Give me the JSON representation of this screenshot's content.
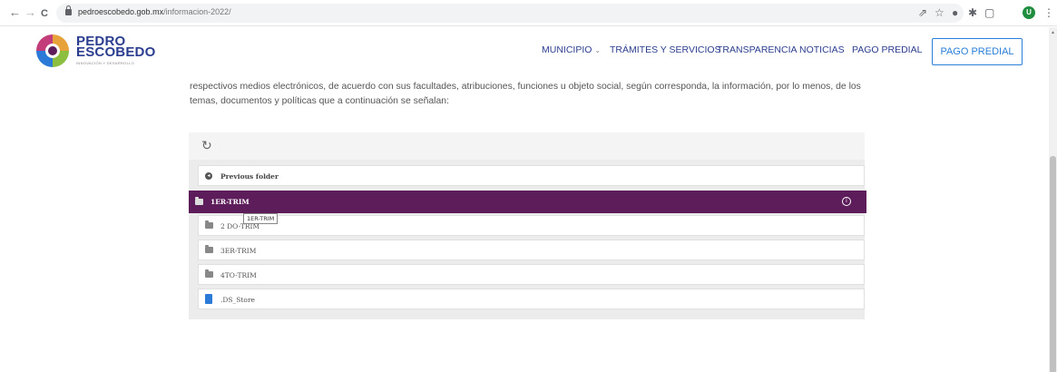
{
  "browser": {
    "back": "←",
    "forward": "→",
    "reload": "C",
    "url_domain": "pedroescobedo.gob.mx",
    "url_path": "/informacion-2022/",
    "profile_initial": "U"
  },
  "site": {
    "logo_line1": "PEDRO",
    "logo_line2": "ESCOBEDO",
    "logo_sub": "INNOVACIÓN Y DESARROLLO",
    "menu": {
      "municipio": "MUNICIPIO",
      "tramites": "TRÁMITES Y SERVICIOS",
      "transparencia": "TRANSPARENCIA",
      "noticias": "NOTICIAS",
      "pago_predial": "PAGO PREDIAL"
    },
    "pago_button": "PAGO PREDIAL"
  },
  "content": {
    "paragraph": "respectivos medios electrónicos, de acuerdo con sus facultades, atribuciones, funciones u objeto social, según corresponda, la información, por lo menos, de los temas, documentos y políticas que a continuación se señalan:"
  },
  "files": {
    "previous": "Previous folder",
    "items": [
      {
        "label": "1ER-TRIM",
        "type": "folder",
        "active": true
      },
      {
        "label": "2 DO-TRIM",
        "type": "folder"
      },
      {
        "label": "3ER-TRIM",
        "type": "folder"
      },
      {
        "label": "4TO-TRIM",
        "type": "folder"
      },
      {
        "label": ".DS_Store",
        "type": "file"
      }
    ],
    "tooltip": "1ER-TRIM"
  },
  "colors": {
    "active_row": "#5c1d5a",
    "brand_blue": "#2b3d8f",
    "button_blue": "#2a7fd8"
  }
}
